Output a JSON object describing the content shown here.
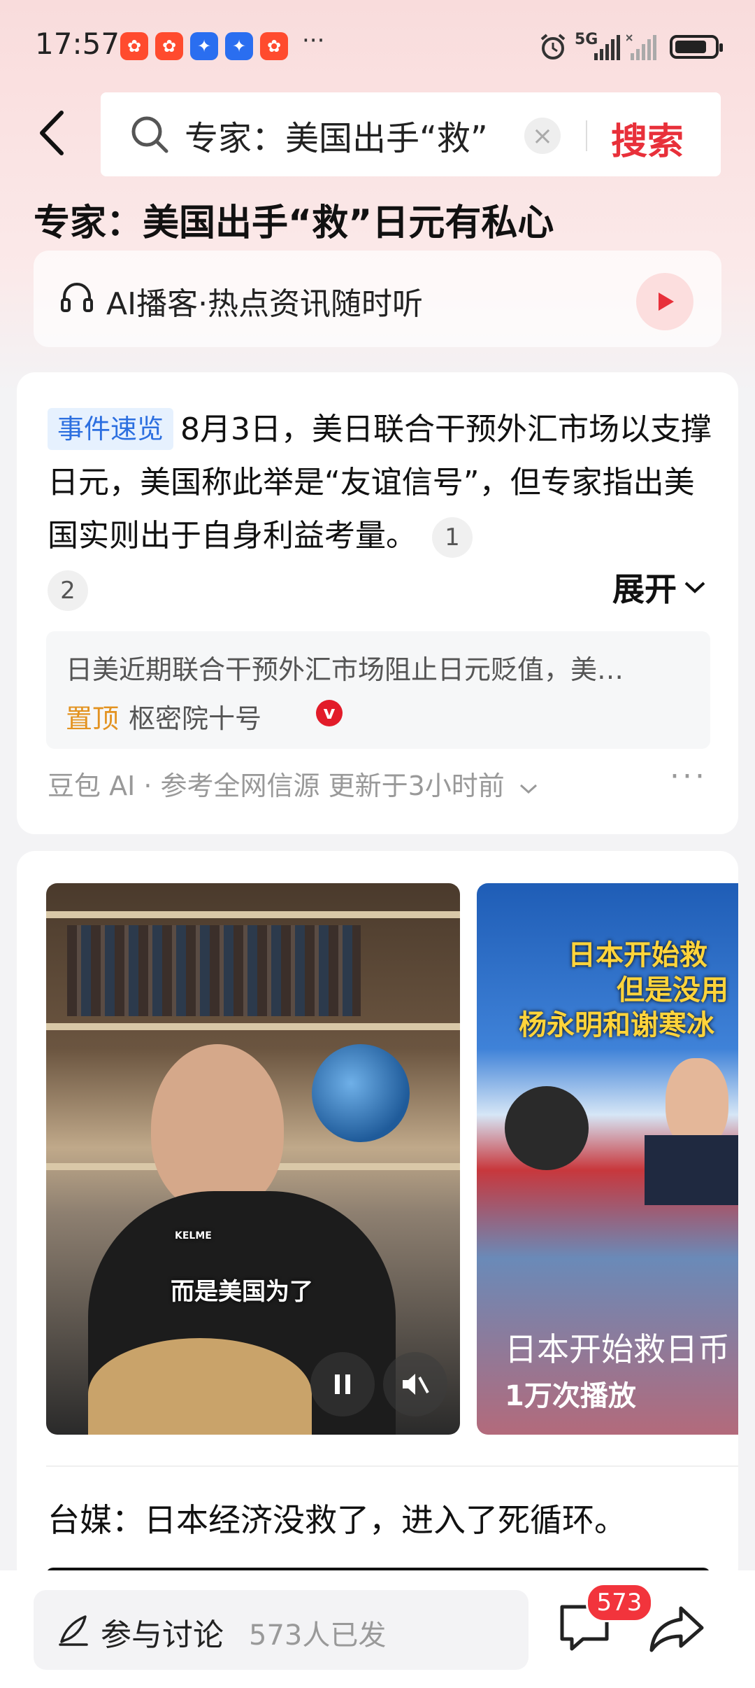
{
  "status_bar": {
    "time": "17:57",
    "app_icons": [
      {
        "name": "xiaohongshu-icon",
        "color": "#ff3b30",
        "glyph": "✿"
      },
      {
        "name": "xiaohongshu-icon-2",
        "color": "#ff3b30",
        "glyph": "✿"
      },
      {
        "name": "tencent-icon",
        "color": "#2a6ef0",
        "glyph": "✦"
      },
      {
        "name": "tencent-icon-2",
        "color": "#2a6ef0",
        "glyph": "✦"
      },
      {
        "name": "xiaohongshu-icon-3",
        "color": "#ff4b2e",
        "glyph": "✿"
      }
    ],
    "more": "···",
    "network": "5G"
  },
  "search": {
    "query": "专家：美国出手“救”",
    "submit_label": "搜索",
    "clear_glyph": "×"
  },
  "page_title": "专家：美国出手“救”日元有私心",
  "podcast": {
    "label": "AI播客·热点资讯随时听"
  },
  "summary": {
    "tag": "事件速览",
    "text": "8月3日，美日联合干预外汇市场以支撑日元，美国称此举是“友谊信号”，但专家指出美国实则出于自身利益考量。",
    "citations": [
      "1",
      "2"
    ],
    "expand_label": "展开",
    "quote_text": "日美近期联合干预外汇市场阻止日元贬值，美…",
    "pinned_label": "置顶",
    "quote_source": "枢密院十号",
    "verified_glyph": "v",
    "source_line": "豆包 AI · 参考全网信源 更新于3小时前",
    "more_glyph": "···"
  },
  "videos": [
    {
      "caption": "而是美国为了",
      "brand": "KELME"
    },
    {
      "overlay_lines": [
        "日本开始救",
        "但是没用",
        "杨永明和谢寒冰"
      ],
      "title": "日本开始救日币",
      "plays": "1万次播放"
    }
  ],
  "headline": "台媒：日本经济没救了，进入了死循环。",
  "bottom_bar": {
    "discuss_label": "参与讨论",
    "discuss_count": "573人已发",
    "comment_badge": "573"
  },
  "colors": {
    "accent": "#e8303a",
    "tag_bg": "#e6f1fe",
    "tag_text": "#2c6fe0",
    "pinned": "#e39321"
  }
}
